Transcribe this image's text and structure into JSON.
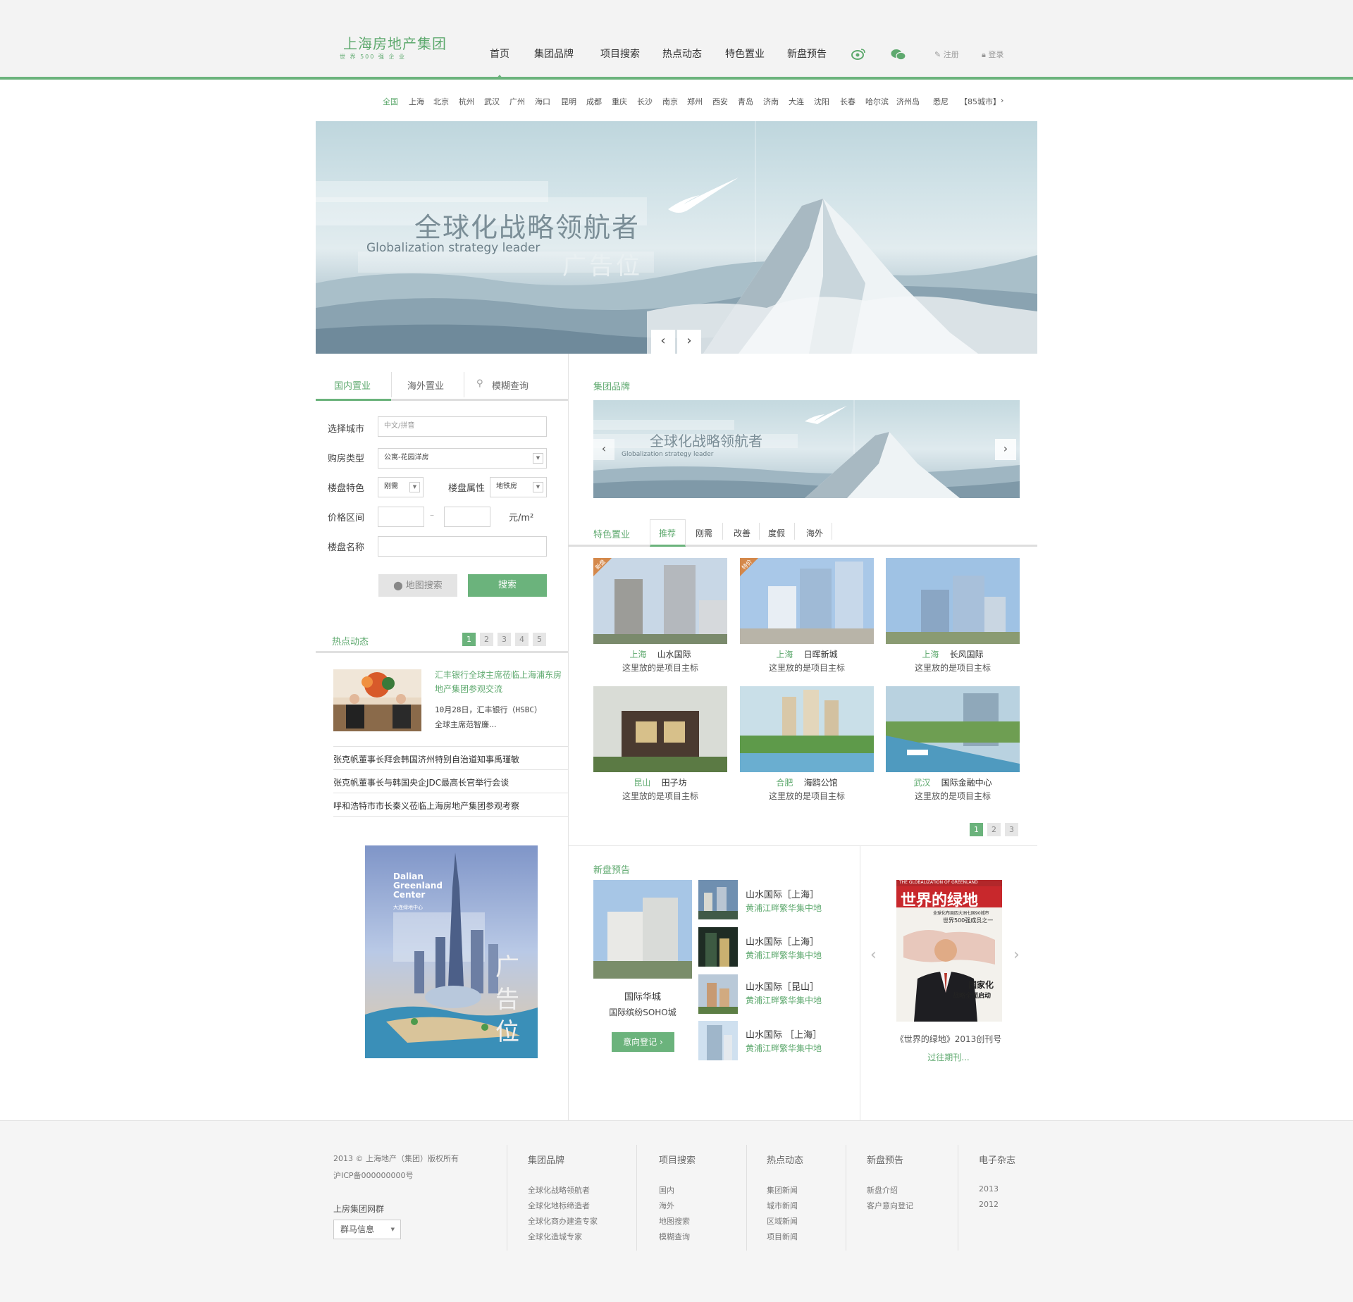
{
  "header": {
    "logo_cn": "上海房地产集团",
    "logo_en": "世 界 500 强 企 业",
    "nav": [
      "首页",
      "集团品牌",
      "项目搜索",
      "热点动态",
      "特色置业",
      "新盘预告"
    ],
    "weibo_icon": "weibo-icon",
    "wechat_icon": "wechat-icon",
    "register": "注册",
    "login": "登录"
  },
  "cities": [
    "全国",
    "上海",
    "北京",
    "杭州",
    "武汉",
    "广州",
    "海口",
    "昆明",
    "成都",
    "重庆",
    "长沙",
    "南京",
    "郑州",
    "西安",
    "青岛",
    "济南",
    "大连",
    "沈阳",
    "长春",
    "哈尔滨",
    "济州岛",
    "悉尼",
    "【85城市】"
  ],
  "banner": {
    "title": "全球化战略领航者",
    "subtitle": "Globalization strategy leader",
    "ad": "广告位",
    "prev": "‹",
    "next": "›"
  },
  "search": {
    "tabs": [
      "国内置业",
      "海外置业",
      "模糊查询"
    ],
    "city_label": "选择城市",
    "city_placeholder": "中文/拼音",
    "type_label": "购房类型",
    "type_value": "公寓-花园洋房",
    "feature_label": "楼盘特色",
    "feature_value": "刚需",
    "attr_label": "楼盘属性",
    "attr_value": "地铁房",
    "price_label": "价格区间",
    "price_sep": "–",
    "price_unit": "元/m²",
    "name_label": "楼盘名称",
    "map_btn": "地图搜索",
    "search_btn": "搜索"
  },
  "hot_news": {
    "title": "热点动态",
    "pages": [
      "1",
      "2",
      "3",
      "4",
      "5"
    ],
    "feature_title": "汇丰银行全球主席莅临上海浦东房地产集团参观交流",
    "feature_desc1": "10月28日，汇丰银行（HSBC）",
    "feature_desc2": "全球主席范智廉...",
    "items": [
      "张克帆董事长拜会韩国济州特别自治道知事禹瑾敏",
      "张克帆董事长与韩国央企JDC最高长官举行会谈",
      "呼和浩特市市长秦义莅临上海房地产集团参观考察"
    ]
  },
  "left_ad": {
    "title1": "Dalian",
    "title2": "Greenland",
    "title3": "Center",
    "sub": "大连绿地中心",
    "ad": "广告位"
  },
  "brand": {
    "title": "集团品牌",
    "banner_title": "全球化战略领航者",
    "banner_sub": "Globalization strategy leader"
  },
  "featured": {
    "title": "特色置业",
    "tabs": [
      "推荐",
      "刚需",
      "改善",
      "度假",
      "海外"
    ],
    "pages": [
      "1",
      "2",
      "3"
    ],
    "items": [
      {
        "city": "上海",
        "name": "山水国际",
        "desc": "这里放的是项目主标",
        "tag": "新盘"
      },
      {
        "city": "上海",
        "name": "日晖新城",
        "desc": "这里放的是项目主标",
        "tag": "特价"
      },
      {
        "city": "上海",
        "name": "长风国际",
        "desc": "这里放的是项目主标",
        "tag": ""
      },
      {
        "city": "昆山",
        "name": "田子坊",
        "desc": "这里放的是项目主标",
        "tag": ""
      },
      {
        "city": "合肥",
        "name": "海鸥公馆",
        "desc": "这里放的是项目主标",
        "tag": ""
      },
      {
        "city": "武汉",
        "name": "国际金融中心",
        "desc": "这里放的是项目主标",
        "tag": ""
      }
    ]
  },
  "new_props": {
    "title": "新盘预告",
    "main_name": "国际华城",
    "main_sub": "国际缤纷SOHO城",
    "register_btn": "意向登记",
    "list": [
      {
        "name": "山水国际［上海］",
        "sub": "黄浦江畔繁华集中地"
      },
      {
        "name": "山水国际［上海］",
        "sub": "黄浦江畔繁华集中地"
      },
      {
        "name": "山水国际［昆山］",
        "sub": "黄浦江畔繁华集中地"
      },
      {
        "name": "山水国际 ［上海］",
        "sub": "黄浦江畔繁华集中地"
      }
    ]
  },
  "magazine": {
    "top": "THE GLOBALIZATION OF GREENLAND",
    "title": "世界的绿地",
    "line1": "全球化布局四大洲七国90城市",
    "line2": "世界500强成员之一",
    "side1": "国家化",
    "side2": "战略全面启动",
    "caption": "《世界的绿地》2013创刊号",
    "past": "过往期刊..."
  },
  "footer": {
    "copyright": "2013 © 上海地产（集团）版权所有",
    "icp": "沪ICP备000000000号",
    "group_label": "上房集团网群",
    "group_select": "群马信息",
    "cols": [
      {
        "title": "集团品牌",
        "links": [
          "全球化战略领航者",
          "全球化地标缔造者",
          "全球化商办建造专家",
          "全球化造城专家"
        ]
      },
      {
        "title": "项目搜索",
        "links": [
          "国内",
          "海外",
          "地图搜索",
          "模糊查询"
        ]
      },
      {
        "title": "热点动态",
        "links": [
          "集团新闻",
          "城市新闻",
          "区域新闻",
          "项目新闻"
        ]
      },
      {
        "title": "新盘预告",
        "links": [
          "新盘介绍",
          "客户意向登记"
        ]
      },
      {
        "title": "电子杂志",
        "links": [
          "2013",
          "2012"
        ]
      }
    ]
  },
  "colors": {
    "accent": "#6bb37c",
    "accent_text": "#5ea96e"
  }
}
